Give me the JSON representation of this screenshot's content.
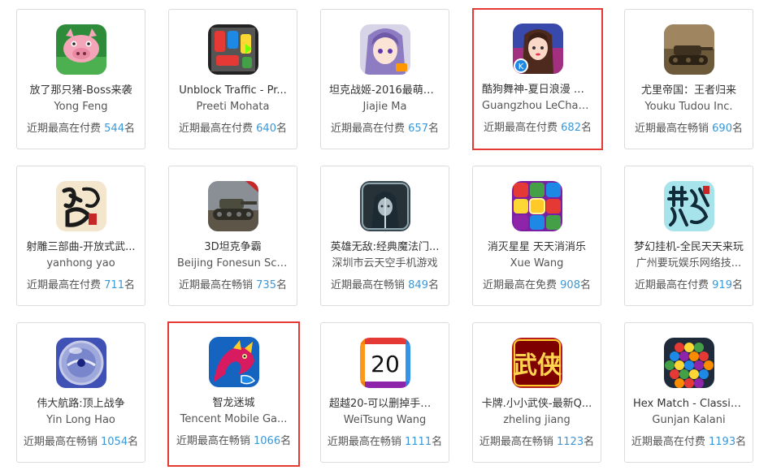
{
  "apps": [
    {
      "name": "放了那只猪-Boss来袭",
      "developer": "Yong Feng",
      "rank_prefix": "近期最高在付费",
      "rank": "544",
      "rank_suffix": "名",
      "icon": "pig-game-icon"
    },
    {
      "name": "Unblock Traffic - Pr...",
      "developer": "Preeti Mohata",
      "rank_prefix": "近期最高在付费",
      "rank": "640",
      "rank_suffix": "名",
      "icon": "traffic-cars-icon"
    },
    {
      "name": "坦克战姬-2016最萌战...",
      "developer": "Jiajie Ma",
      "rank_prefix": "近期最高在付费",
      "rank": "657",
      "rank_suffix": "名",
      "icon": "anime-girl-icon"
    },
    {
      "name": "酷狗舞神-夏日浪漫 青...",
      "developer": "Guangzhou LeChan...",
      "rank_prefix": "近期最高在付费",
      "rank": "682",
      "rank_suffix": "名",
      "icon": "dancer-girl-icon",
      "highlighted": true
    },
    {
      "name": "尤里帝国：王者归来",
      "developer": "Youku Tudou Inc.",
      "rank_prefix": "近期最高在畅销",
      "rank": "690",
      "rank_suffix": "名",
      "icon": "tank-sepia-icon"
    },
    {
      "name": "射雕三部曲-开放式武...",
      "developer": "yanhong yao",
      "rank_prefix": "近期最高在付费",
      "rank": "711",
      "rank_suffix": "名",
      "icon": "calligraphy-eagle-icon"
    },
    {
      "name": "3D坦克争霸",
      "developer": "Beijing Fonesun Scie...",
      "rank_prefix": "近期最高在畅销",
      "rank": "735",
      "rank_suffix": "名",
      "icon": "tank-3d-icon"
    },
    {
      "name": "英雄无敌:经典魔法门...",
      "developer": "深圳市云天空手机游戏",
      "rank_prefix": "近期最高在畅销",
      "rank": "849",
      "rank_suffix": "名",
      "icon": "hooded-hero-icon"
    },
    {
      "name": "消灭星星 天天消消乐",
      "developer": "Xue Wang",
      "rank_prefix": "近期最高在免费",
      "rank": "908",
      "rank_suffix": "名",
      "icon": "match-blocks-icon"
    },
    {
      "name": "梦幻挂机-全民天天来玩",
      "developer": "广州要玩娱乐网络技...",
      "rank_prefix": "近期最高在付费",
      "rank": "919",
      "rank_suffix": "名",
      "icon": "dream-calligraphy-icon"
    },
    {
      "name": "伟大航路:顶上战争",
      "developer": "Yin Long Hao",
      "rank_prefix": "近期最高在畅销",
      "rank": "1054",
      "rank_suffix": "名",
      "icon": "glass-orb-icon"
    },
    {
      "name": "智龙迷城",
      "developer": "Tencent Mobile Ga...",
      "rank_prefix": "近期最高在畅销",
      "rank": "1066",
      "rank_suffix": "名",
      "icon": "dragon-icon",
      "highlighted": true
    },
    {
      "name": "超越20-可以删掉手机...",
      "developer": "WeiTsung Wang",
      "rank_prefix": "近期最高在畅销",
      "rank": "1111",
      "rank_suffix": "名",
      "icon": "number-20-icon",
      "icon_text": "20"
    },
    {
      "name": "卡牌.小小武侠-最新Q...",
      "developer": "zheling jiang",
      "rank_prefix": "近期最高在畅销",
      "rank": "1123",
      "rank_suffix": "名",
      "icon": "wuxia-card-icon",
      "icon_text": "武侠"
    },
    {
      "name": "Hex Match - Classic ...",
      "developer": "Gunjan Kalani",
      "rank_prefix": "近期最高在付费",
      "rank": "1193",
      "rank_suffix": "名",
      "icon": "hex-balls-icon"
    }
  ]
}
